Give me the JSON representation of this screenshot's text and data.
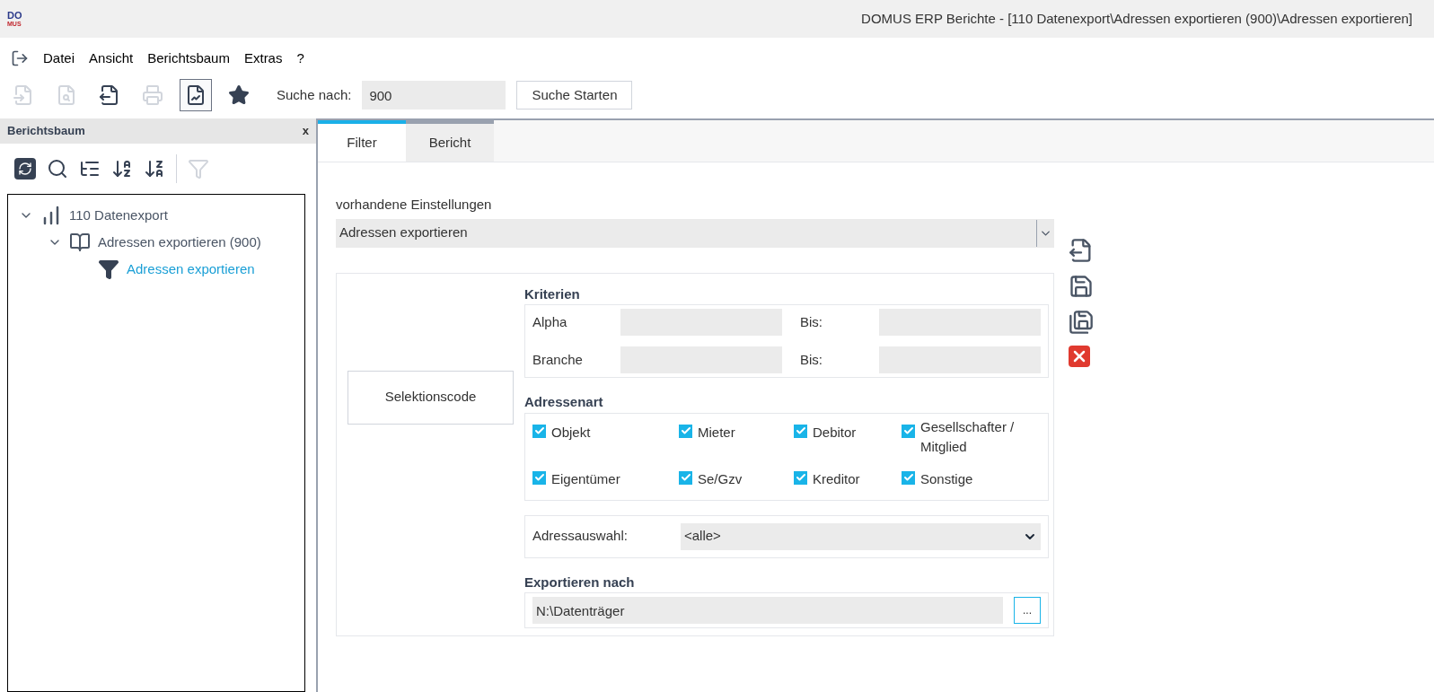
{
  "window": {
    "title": "DOMUS ERP Berichte - [110 Datenexport\\Adressen exportieren (900)\\Adressen exportieren]",
    "logo_top": "DO",
    "logo_bottom": "MUS"
  },
  "menu": [
    "Datei",
    "Ansicht",
    "Berichtsbaum",
    "Extras",
    "?"
  ],
  "toolbar": {
    "buttons": [
      {
        "disabled": true,
        "pressed": false
      },
      {
        "disabled": true,
        "pressed": false
      },
      {
        "disabled": false,
        "pressed": false
      },
      {
        "disabled": true,
        "pressed": false
      },
      {
        "disabled": false,
        "pressed": true
      },
      {
        "disabled": false,
        "pressed": false
      }
    ],
    "search_label": "Suche nach:",
    "search_value": "900",
    "search_button": "Suche Starten"
  },
  "sidebar": {
    "title": "Berichtsbaum",
    "close": "x",
    "tree": [
      {
        "label": "110 Datenexport",
        "expanded": true,
        "selected": false,
        "children": [
          {
            "label": "Adressen exportieren (900)",
            "expanded": true,
            "selected": false,
            "children": [
              {
                "label": "Adressen exportieren",
                "selected": true
              }
            ]
          }
        ]
      }
    ]
  },
  "tabs": [
    {
      "label": "Filter",
      "selected": true
    },
    {
      "label": "Bericht",
      "selected": false
    }
  ],
  "settings": {
    "label": "vorhandene Einstellungen",
    "value": "Adressen exportieren"
  },
  "selection_button": "Selektionscode",
  "criteria": {
    "title": "Kriterien",
    "rows": [
      {
        "label": "Alpha",
        "to_label": "Bis:"
      },
      {
        "label": "Branche",
        "to_label": "Bis:"
      }
    ]
  },
  "address_types": {
    "title": "Adressenart",
    "items": [
      {
        "label": "Objekt",
        "checked": true
      },
      {
        "label": "Mieter",
        "checked": true
      },
      {
        "label": "Debitor",
        "checked": true
      },
      {
        "label": "Gesellschafter / Mitglied",
        "checked": true
      },
      {
        "label": "Eigentümer",
        "checked": true
      },
      {
        "label": "Se/Gzv",
        "checked": true
      },
      {
        "label": "Kreditor",
        "checked": true
      },
      {
        "label": "Sonstige",
        "checked": true
      }
    ]
  },
  "address_selection": {
    "label": "Adressauswahl:",
    "value": "<alle>"
  },
  "export": {
    "title": "Exportieren nach",
    "value": "N:\\Datenträger",
    "browse": "..."
  }
}
